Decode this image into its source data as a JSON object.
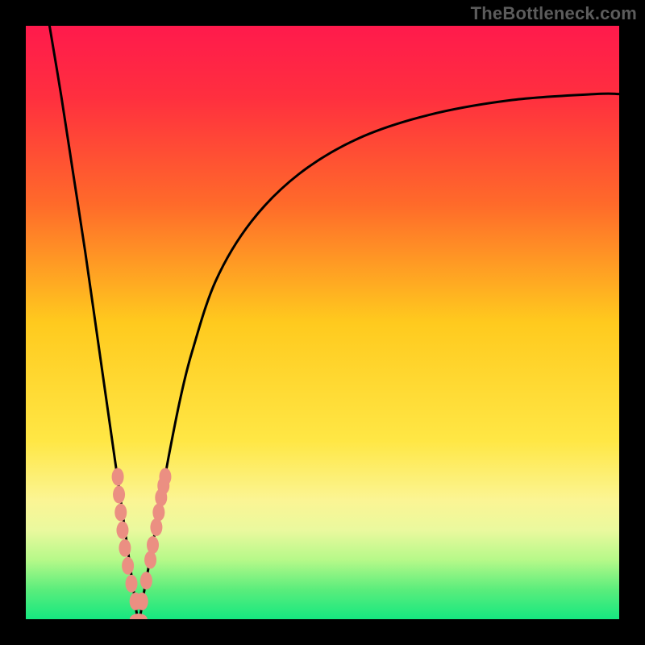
{
  "watermark": "TheBottleneck.com",
  "colors": {
    "frame": "#000000",
    "curve": "#000000",
    "marker_fill": "#eb8f82",
    "marker_stroke": "#eb8f82",
    "gradient_stops": [
      {
        "offset": 0.0,
        "color": "#ff1a4c"
      },
      {
        "offset": 0.12,
        "color": "#ff2f3f"
      },
      {
        "offset": 0.3,
        "color": "#ff6a2a"
      },
      {
        "offset": 0.5,
        "color": "#ffca1e"
      },
      {
        "offset": 0.7,
        "color": "#ffe745"
      },
      {
        "offset": 0.8,
        "color": "#fbf594"
      },
      {
        "offset": 0.85,
        "color": "#eaf99e"
      },
      {
        "offset": 0.9,
        "color": "#b6f989"
      },
      {
        "offset": 0.95,
        "color": "#5bed7c"
      },
      {
        "offset": 1.0,
        "color": "#15e880"
      }
    ]
  },
  "chart_data": {
    "type": "line",
    "title": "",
    "xlabel": "",
    "ylabel": "",
    "xlim": [
      0,
      100
    ],
    "ylim": [
      0,
      100
    ],
    "grid": false,
    "legend": false,
    "notes": "V-shaped bottleneck curve on red→green vertical gradient. x is a normalized hardware-balance axis (0–100), y is bottleneck severity (0 = none / green, 100 = max / red). Minimum at x≈19.",
    "series": [
      {
        "name": "bottleneck-curve",
        "x": [
          4,
          6,
          8,
          10,
          12,
          14,
          16,
          18,
          19,
          20,
          22,
          24,
          26,
          28,
          32,
          38,
          46,
          56,
          68,
          82,
          96,
          100
        ],
        "y": [
          100,
          88,
          75,
          62,
          48,
          34,
          20,
          6,
          0,
          5,
          16,
          27,
          37,
          45,
          57,
          67,
          75,
          81,
          85,
          87.5,
          88.5,
          88.5
        ]
      }
    ],
    "markers": {
      "name": "highlight-points",
      "x": [
        15.5,
        15.7,
        16.0,
        16.3,
        16.7,
        17.2,
        17.8,
        18.5,
        19.0,
        19.6,
        20.3,
        21.0,
        21.4,
        22.0,
        22.4,
        22.8,
        23.2,
        23.5
      ],
      "y": [
        24,
        21,
        18,
        15,
        12,
        9,
        6,
        3,
        0,
        3,
        6.5,
        10,
        12.5,
        15.5,
        18,
        20.5,
        22.5,
        24
      ]
    },
    "optimum_x": 19
  }
}
